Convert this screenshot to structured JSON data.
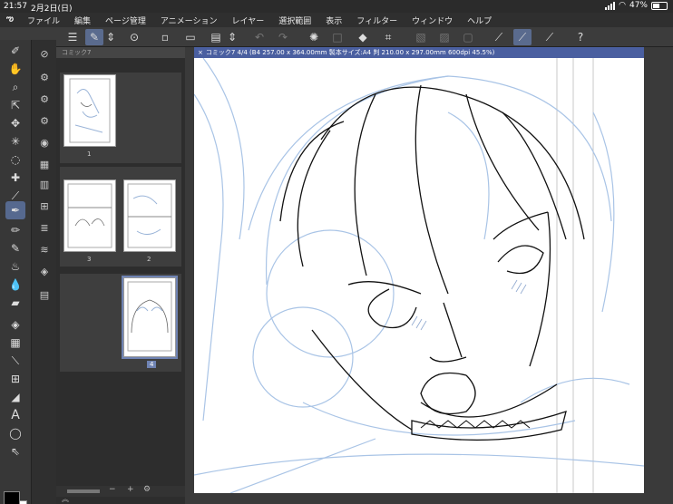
{
  "status": {
    "time": "21:57",
    "date": "2月2日(日)",
    "battery": "47%",
    "battery_level": 0.47
  },
  "menu": {
    "items": [
      "ファイル",
      "編集",
      "ページ管理",
      "アニメーション",
      "レイヤー",
      "選択範囲",
      "表示",
      "フィルター",
      "ウィンドウ",
      "ヘルプ"
    ]
  },
  "page_manager": {
    "tab": "コミック7",
    "pages": [
      {
        "number": "1"
      },
      {
        "number": "3"
      },
      {
        "number": "2"
      },
      {
        "number": "4"
      }
    ],
    "selected_page": "4",
    "bottom": {
      "minus": "−",
      "plus": "+"
    }
  },
  "canvas": {
    "tab_close": "×",
    "tab_title": "コミック7 4/4 (B4 257.00 x 364.00mm 製本サイズ:A4 判 210.00 x 297.00mm 600dpi 45.5%)"
  },
  "colors": {
    "accent": "#56698f",
    "tab_active": "#4a5fa0",
    "sketch_blue": "#a9c4e6",
    "ink": "#111111",
    "main_color": "#000000",
    "sub_color": "#ffffff"
  }
}
